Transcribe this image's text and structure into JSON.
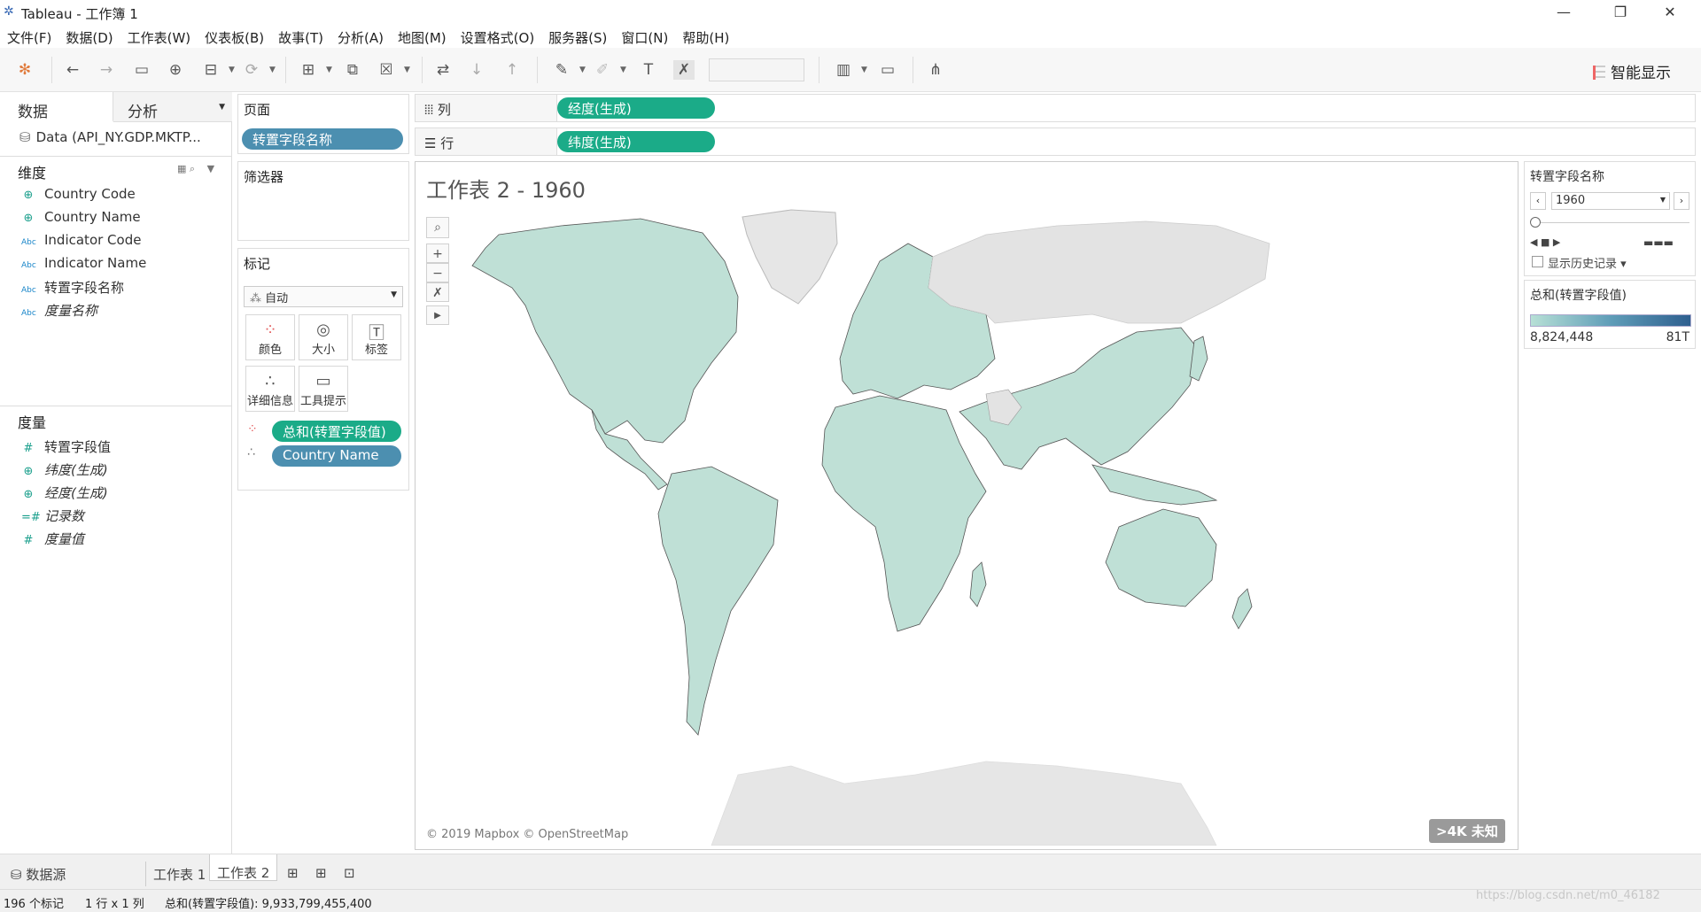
{
  "window": {
    "title": "Tableau - 工作簿 1",
    "minimize": "—",
    "restore": "❐",
    "close": "✕"
  },
  "menu": [
    "文件(F)",
    "数据(D)",
    "工作表(W)",
    "仪表板(B)",
    "故事(T)",
    "分析(A)",
    "地图(M)",
    "设置格式(O)",
    "服务器(S)",
    "窗口(N)",
    "帮助(H)"
  ],
  "toolbar": {
    "show_me": "智能显示"
  },
  "left": {
    "tab_data": "数据",
    "tab_analysis": "分析",
    "datasource": "Data (API_NY.GDP.MKTP...",
    "dimensions_header": "维度",
    "dimensions": [
      {
        "type": "geo",
        "name": "Country Code"
      },
      {
        "type": "geo",
        "name": "Country Name"
      },
      {
        "type": "abc",
        "name": "Indicator Code"
      },
      {
        "type": "abc",
        "name": "Indicator Name"
      },
      {
        "type": "abc",
        "name": "转置字段名称"
      },
      {
        "type": "abc",
        "name": "度量名称"
      }
    ],
    "measures_header": "度量",
    "measures": [
      {
        "type": "num",
        "name": "转置字段值"
      },
      {
        "type": "geo",
        "name": "纬度(生成)"
      },
      {
        "type": "geo",
        "name": "经度(生成)"
      },
      {
        "type": "num",
        "name": "记录数"
      },
      {
        "type": "num",
        "name": "度量值"
      }
    ]
  },
  "shelves": {
    "pages_header": "页面",
    "pages_pill": "转置字段名称",
    "filters_header": "筛选器",
    "marks_header": "标记",
    "marks_type": "自动",
    "mark_buttons": [
      "颜色",
      "大小",
      "标签",
      "详细信息",
      "工具提示"
    ],
    "marks_pills": [
      "总和(转置字段值)",
      "Country Name"
    ],
    "columns_label": "列",
    "columns_pill": "经度(生成)",
    "rows_label": "行",
    "rows_pill": "纬度(生成)"
  },
  "view": {
    "title": "工作表 2 - 1960",
    "attribution": "© 2019 Mapbox © OpenStreetMap",
    "unknown_badge": ">4K 未知"
  },
  "page_control": {
    "header": "转置字段名称",
    "value": "1960",
    "show_history": "显示历史记录"
  },
  "legend": {
    "header": "总和(转置字段值)",
    "min": "8,824,448",
    "max": "81T",
    "colors": {
      "low": "#b7e0d6",
      "high": "#2e5f8f"
    }
  },
  "bottom_tabs": {
    "datasource": "数据源",
    "sheet1": "工作表 1",
    "sheet2": "工作表 2"
  },
  "status": {
    "marks": "196 个标记",
    "rowscols": "1 行 x 1 列",
    "sum": "总和(转置字段值): 9,933,799,455,400"
  },
  "watermark": "https://blog.csdn.net/m0_46182"
}
